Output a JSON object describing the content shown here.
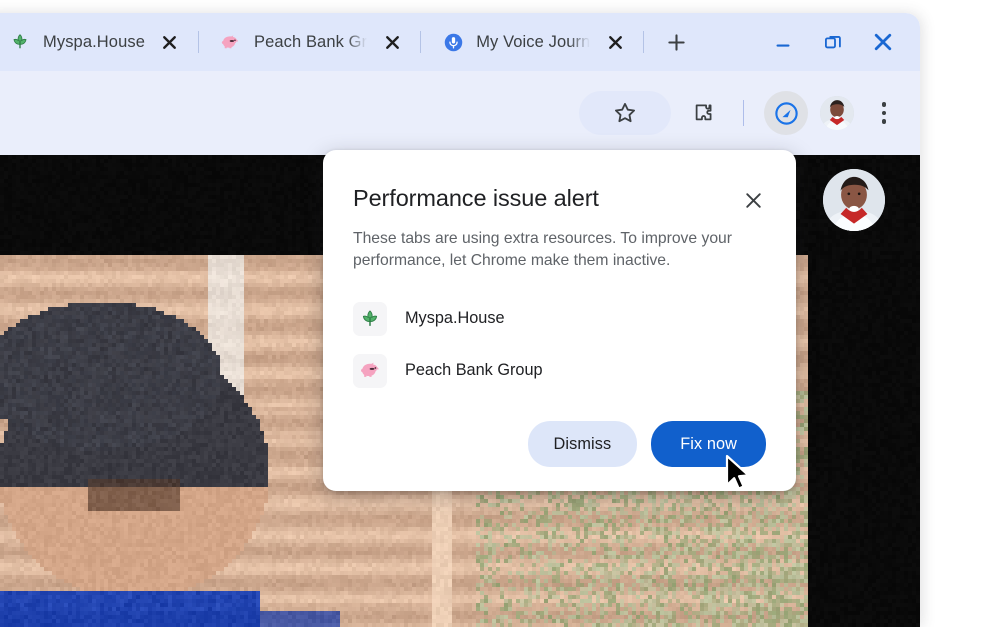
{
  "window": {
    "title": "Google Chrome",
    "controls": [
      {
        "name": "minimize",
        "label": "–",
        "icon": "minimize-icon"
      },
      {
        "name": "restore",
        "label": "❐",
        "icon": "restore-icon"
      },
      {
        "name": "close",
        "label": "✕",
        "icon": "close-icon"
      }
    ]
  },
  "tabstrip": {
    "new_tab_label": "+",
    "new_tab_tooltip": "New tab",
    "tabs": [
      {
        "title": "Myspa.House",
        "favicon": "leaf-icon",
        "close_label": "✕",
        "truncated": false
      },
      {
        "title": "Peach Bank Gr",
        "favicon": "piggy-bank-icon",
        "close_label": "✕",
        "truncated": true
      },
      {
        "title": "My Voice Journ",
        "favicon": "microphone-icon",
        "close_label": "✕",
        "truncated": true
      }
    ]
  },
  "toolbar": {
    "icons": [
      {
        "name": "bookmark-star-icon",
        "label": "Bookmark this tab",
        "highlighted": true
      },
      {
        "name": "extensions-puzzle-icon",
        "label": "Extensions",
        "highlighted": false
      },
      {
        "name": "performance-speedometer-icon",
        "label": "Performance",
        "highlighted": true
      },
      {
        "name": "profile-avatar",
        "label": "Profile",
        "highlighted": false
      },
      {
        "name": "chrome-menu-icon",
        "label": "Customize and control Google Chrome",
        "highlighted": false
      }
    ]
  },
  "dialog": {
    "title": "Performance issue alert",
    "close_label": "✕",
    "body": "These tabs are using extra resources. To improve your performance, let Chrome make them inactive.",
    "tabs": [
      {
        "label": "Myspa.House",
        "favicon": "leaf-icon"
      },
      {
        "label": "Peach Bank Group",
        "favicon": "piggy-bank-icon"
      }
    ],
    "dismiss_label": "Dismiss",
    "fix_label": "Fix now"
  },
  "colors": {
    "tabstrip_bg": "#dfe7fb",
    "toolbar_bg": "#eaeefb",
    "primary_button": "#1160cc",
    "secondary_button": "#dde6f9",
    "dialog_bg": "#ffffff",
    "title_text": "#202124",
    "body_text": "#5f6368",
    "window_control": "#1967d2",
    "leaf_green": "#4caf63",
    "piggy_pink": "#f48fb1",
    "mic_blue": "#4285f4"
  }
}
